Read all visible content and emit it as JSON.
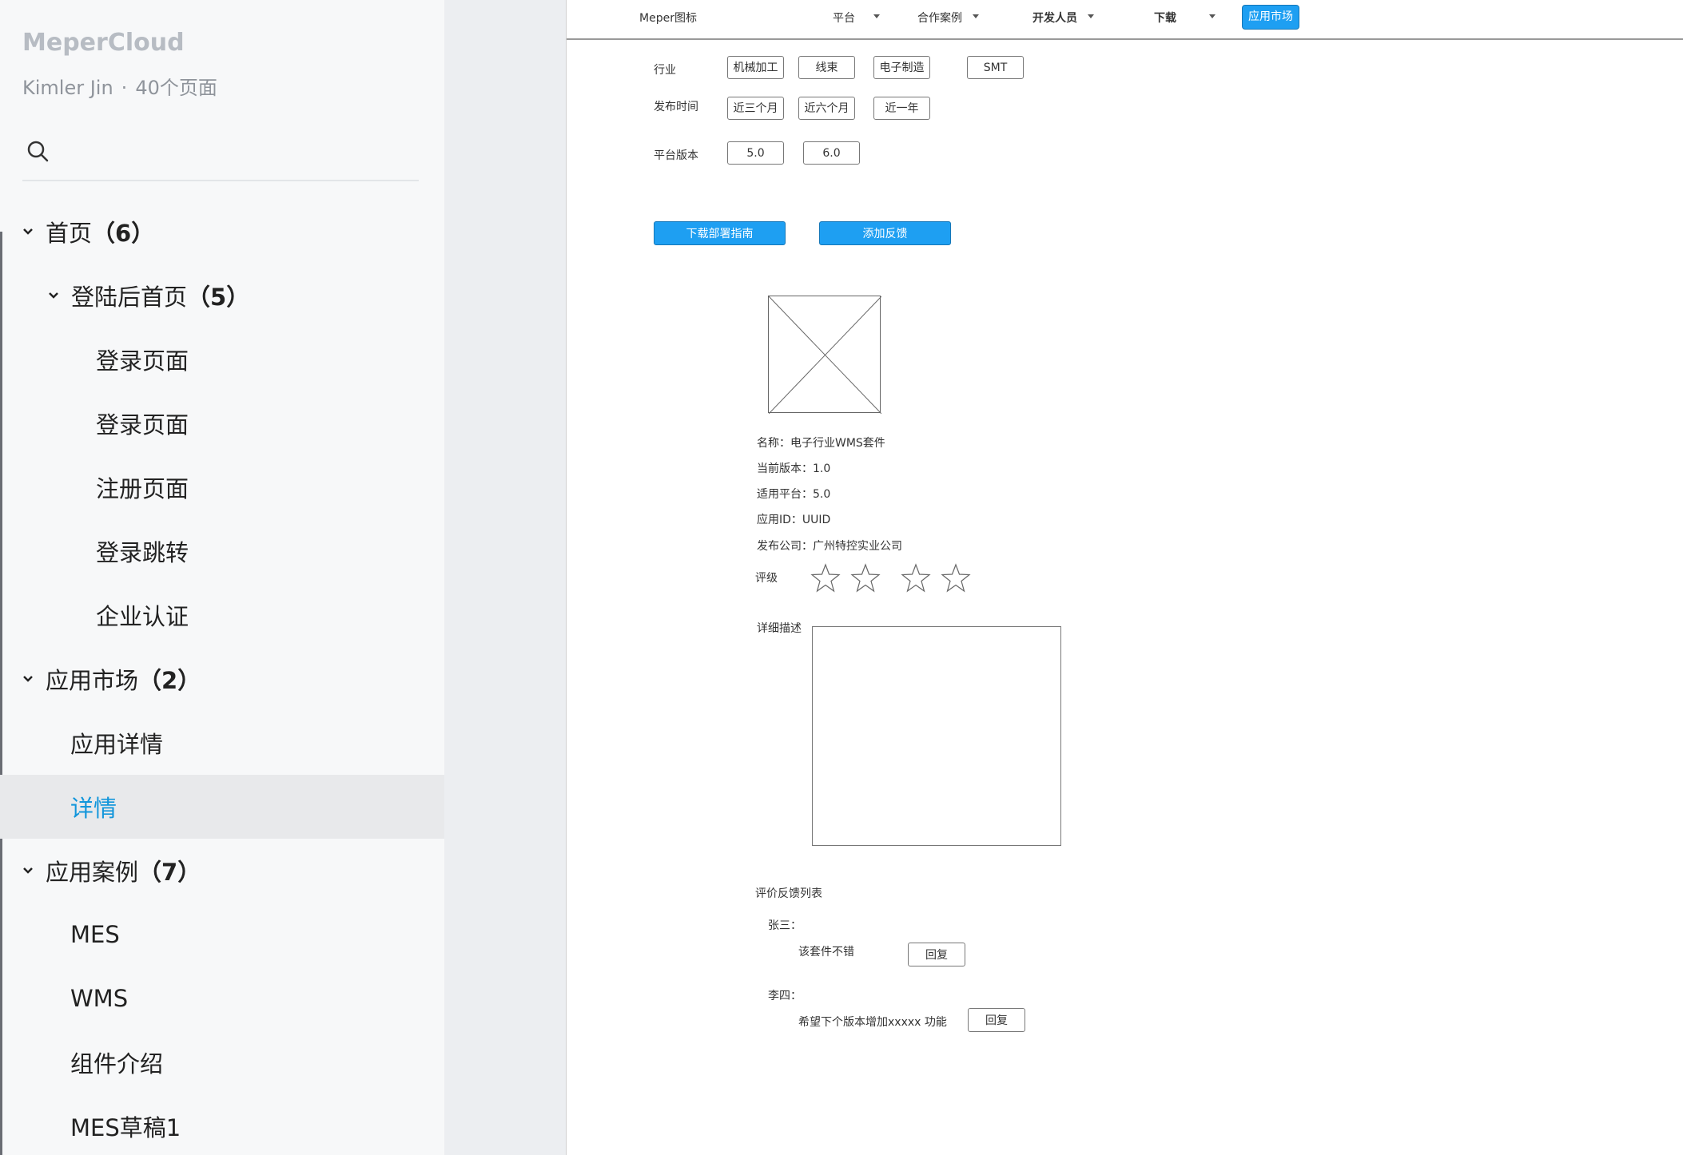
{
  "sidebar": {
    "brand": "MeperCloud",
    "owner": "Kimler Jin",
    "separator": "·",
    "page_count": "40个页面",
    "tree": [
      {
        "label": "首页",
        "count": "（6）",
        "level": 0,
        "expanded": true
      },
      {
        "label": "登陆后首页",
        "count": "（5）",
        "level": 1,
        "expanded": true
      },
      {
        "label": "登录页面",
        "level": 2
      },
      {
        "label": "登录页面",
        "level": 2
      },
      {
        "label": "注册页面",
        "level": 2
      },
      {
        "label": "登录跳转",
        "level": 2
      },
      {
        "label": "企业认证",
        "level": 2
      },
      {
        "label": "应用市场",
        "count": "（2）",
        "level": 0,
        "expanded": true
      },
      {
        "label": "应用详情",
        "level": 1
      },
      {
        "label": "详情",
        "level": 1,
        "active": true
      },
      {
        "label": "应用案例",
        "count": "（7）",
        "level": 0,
        "expanded": true
      },
      {
        "label": "MES",
        "level": 1
      },
      {
        "label": "WMS",
        "level": 1
      },
      {
        "label": "组件介绍",
        "level": 1
      },
      {
        "label": "MES草稿1",
        "level": 1
      }
    ]
  },
  "nav": {
    "logo": "Meper图标",
    "items": [
      "平台",
      "合作案例",
      "开发人员",
      "下载"
    ],
    "active": "应用市场"
  },
  "filters": {
    "industry_label": "行业",
    "industry": [
      "机械加工",
      "线束",
      "电子制造",
      "SMT"
    ],
    "time_label": "发布时间",
    "time": [
      "近三个月",
      "近六个月",
      "近一年"
    ],
    "version_label": "平台版本",
    "version": [
      "5.0",
      "6.0"
    ]
  },
  "actions": {
    "download": "下载部署指南",
    "feedback": "添加反馈"
  },
  "app": {
    "name": "名称：电子行业WMS套件",
    "version": "当前版本：1.0",
    "platform": "适用平台：5.0",
    "app_id": "应用ID：UUID",
    "publisher": "发布公司：广州特控实业公司",
    "rating_label": "评级",
    "rating_value": 0,
    "rating_max": 4,
    "description_label": "详细描述"
  },
  "feedback": {
    "title": "评价反馈列表",
    "items": [
      {
        "user": "张三：",
        "comment": "该套件不错",
        "reply": "回复"
      },
      {
        "user": "李四：",
        "comment": "希望下个版本增加xxxxx 功能",
        "reply": "回复"
      }
    ]
  },
  "colors": {
    "accent": "#1e9ff2",
    "active_text": "#1296db",
    "sidebar_bg": "#f7f8f9",
    "gutter_bg": "#eceef1"
  }
}
